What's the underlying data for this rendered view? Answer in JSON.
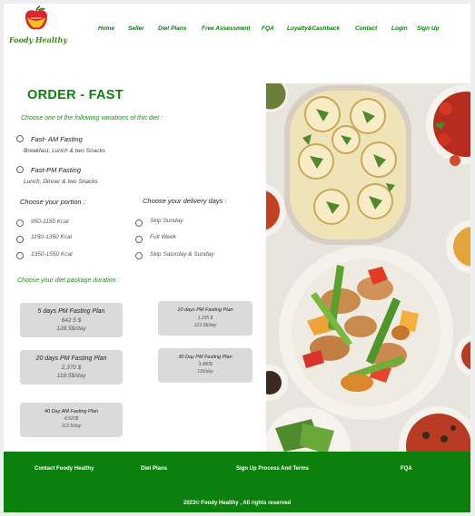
{
  "brand": {
    "name": "Foody Healthy"
  },
  "nav": [
    "Home",
    "Seller",
    "Diet Plans",
    "Free Assessment",
    "FQA",
    "Loyalty&Cashback",
    "Contact",
    "Login",
    "Sign Up"
  ],
  "order": {
    "title": "ORDER - FAST",
    "variation_prompt": "Choose one of the following variations of this diet :",
    "variations": [
      {
        "label": "Fast- AM Fasting",
        "detail": "Breakfast, Lunch & two Snacks"
      },
      {
        "label": "Fast-PM Fasting",
        "detail": "Lunch, Dinner & two Snacks"
      }
    ],
    "portion_prompt": "Choose your portion :",
    "portions": [
      "950-1150 Kcal",
      "1150-1350 Kcal",
      "1350-1550 Kcal"
    ],
    "delivery_prompt": "Choose your delivery days :",
    "delivery_days": [
      "Skip Sunday",
      "Full Week",
      "Skip Saturday & Sunday"
    ],
    "duration_prompt": "Choose your diet package duration :",
    "plans": [
      {
        "title": "5 days PM Fasting Plan",
        "price": "642.5 $",
        "per_day": "128.5$/day"
      },
      {
        "title": "10 days PM Fasting Plan",
        "price": "1,235 $",
        "per_day": "123.5$/day"
      },
      {
        "title": "20 days PM Fasting Plan",
        "price": "2,370 $",
        "per_day": "118.5$/day"
      },
      {
        "title": "30 Day  PM Fasting Plan",
        "price": "3,480$",
        "per_day": "116/day"
      },
      {
        "title": "40 Day AM  Fasting Plan",
        "price": "4,520$",
        "per_day": "113.5/day"
      }
    ]
  },
  "footer": {
    "links": [
      "Contact Foody Healthy",
      "Diet Plans",
      "Sign Up Process And Terms",
      "FQA"
    ],
    "copyright": "2023© Foody Healthy , All rights reserved"
  },
  "colors": {
    "brand_green": "#0c800c",
    "card_gray": "#dadada"
  }
}
